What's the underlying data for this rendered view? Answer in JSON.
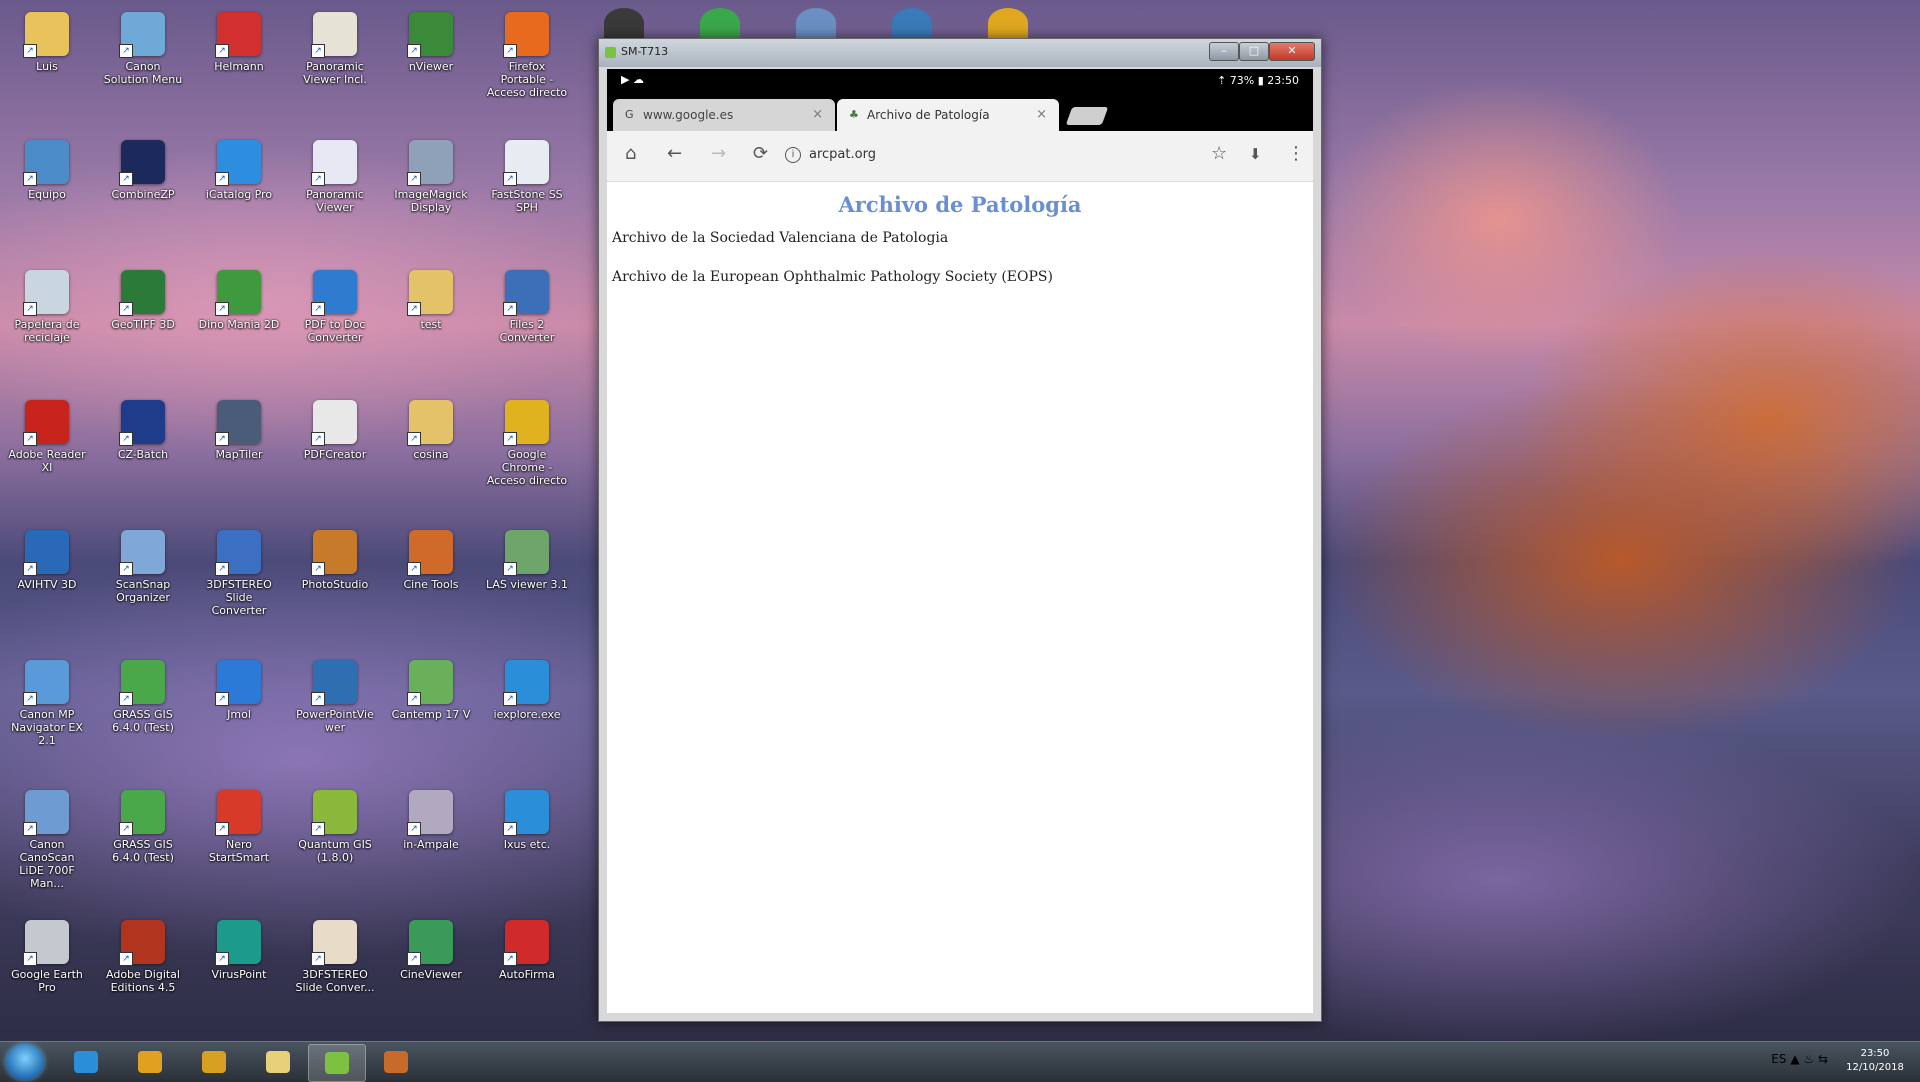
{
  "desktop": {
    "icons": [
      {
        "label": "Luis",
        "color": "#e8c25a",
        "col": 0,
        "row": 0
      },
      {
        "label": "Canon Solution Menu",
        "color": "#6fa9d8",
        "col": 1,
        "row": 0
      },
      {
        "label": "Helmann",
        "color": "#d22f2f",
        "col": 2,
        "row": 0
      },
      {
        "label": "Panoramic Viewer Incl.",
        "color": "#e6e2d6",
        "col": 3,
        "row": 0
      },
      {
        "label": "nViewer",
        "color": "#3b8a3a",
        "col": 4,
        "row": 0
      },
      {
        "label": "Firefox Portable - Acceso directo",
        "color": "#e86a1f",
        "col": 5,
        "row": 0
      },
      {
        "label": "Equipo",
        "color": "#4c8cc9",
        "col": 0,
        "row": 1
      },
      {
        "label": "CombineZP",
        "color": "#1b2a5a",
        "col": 1,
        "row": 1
      },
      {
        "label": "iCatalog Pro",
        "color": "#2d8ee0",
        "col": 2,
        "row": 1
      },
      {
        "label": "Panoramic Viewer",
        "color": "#e8e8f4",
        "col": 3,
        "row": 1
      },
      {
        "label": "ImageMagick Display",
        "color": "#8fa1b8",
        "col": 4,
        "row": 1
      },
      {
        "label": "FastStone SS SPH",
        "color": "#e6ecf2",
        "col": 5,
        "row": 1
      },
      {
        "label": "Papelera de reciclaje",
        "color": "#c9d6e2",
        "col": 0,
        "row": 2
      },
      {
        "label": "GeoTIFF 3D",
        "color": "#2b7a3a",
        "col": 1,
        "row": 2
      },
      {
        "label": "Dino Mania 2D",
        "color": "#3f9a3f",
        "col": 2,
        "row": 2
      },
      {
        "label": "PDF to Doc Converter",
        "color": "#2f7bd0",
        "col": 3,
        "row": 2
      },
      {
        "label": "test",
        "color": "#e3c26a",
        "col": 4,
        "row": 2
      },
      {
        "label": "Files 2 Converter",
        "color": "#3c6fb8",
        "col": 5,
        "row": 2
      },
      {
        "label": "Adobe Reader XI",
        "color": "#c8241e",
        "col": 0,
        "row": 3
      },
      {
        "label": "CZ-Batch",
        "color": "#1f3c8a",
        "col": 1,
        "row": 3
      },
      {
        "label": "MapTiler",
        "color": "#4a5c78",
        "col": 2,
        "row": 3
      },
      {
        "label": "PDFCreator",
        "color": "#e8e8e8",
        "col": 3,
        "row": 3
      },
      {
        "label": "cosina",
        "color": "#e3c26a",
        "col": 4,
        "row": 3
      },
      {
        "label": "Google Chrome - Acceso directo",
        "color": "#e0b21f",
        "col": 5,
        "row": 3
      },
      {
        "label": "AVIHTV 3D",
        "color": "#2a68b8",
        "col": 0,
        "row": 4
      },
      {
        "label": "ScanSnap Organizer",
        "color": "#7fa7d8",
        "col": 1,
        "row": 4
      },
      {
        "label": "3DFSTEREO Slide Converter",
        "color": "#3a6fc2",
        "col": 2,
        "row": 4
      },
      {
        "label": "PhotoStudio",
        "color": "#c67a2a",
        "col": 3,
        "row": 4
      },
      {
        "label": "Cine Tools",
        "color": "#d06a2a",
        "col": 4,
        "row": 4
      },
      {
        "label": "LAS viewer 3.1",
        "color": "#6ea56a",
        "col": 5,
        "row": 4
      },
      {
        "label": "Canon MP Navigator EX 2.1",
        "color": "#5a9ad8",
        "col": 0,
        "row": 5
      },
      {
        "label": "GRASS GIS 6.4.0 (Test)",
        "color": "#4aa84a",
        "col": 1,
        "row": 5
      },
      {
        "label": "Jmol",
        "color": "#2b7ad8",
        "col": 2,
        "row": 5
      },
      {
        "label": "PowerPointViewer",
        "color": "#2d6fb0",
        "col": 3,
        "row": 5
      },
      {
        "label": "Cantemp 17 V",
        "color": "#6ab05a",
        "col": 4,
        "row": 5
      },
      {
        "label": "iexplore.exe",
        "color": "#2a8fd8",
        "col": 5,
        "row": 5
      },
      {
        "label": "Canon CanoScan LiDE 700F Man...",
        "color": "#6e9cd2",
        "col": 0,
        "row": 6
      },
      {
        "label": "GRASS GIS 6.4.0 (Test)",
        "color": "#4aa84a",
        "col": 1,
        "row": 6
      },
      {
        "label": "Nero StartSmart",
        "color": "#d83a2a",
        "col": 2,
        "row": 6
      },
      {
        "label": "Quantum GIS (1.8.0)",
        "color": "#8ab83a",
        "col": 3,
        "row": 6
      },
      {
        "label": "in-Ampale",
        "color": "#b0a9c0",
        "col": 4,
        "row": 6
      },
      {
        "label": "Ixus etc.",
        "color": "#2a8fd8",
        "col": 5,
        "row": 6
      },
      {
        "label": "Google Earth Pro",
        "color": "#c4c9d0",
        "col": 0,
        "row": 7
      },
      {
        "label": "Adobe Digital Editions 4.5",
        "color": "#b0341e",
        "col": 1,
        "row": 7
      },
      {
        "label": "VirusPoint",
        "color": "#1c9a8c",
        "col": 2,
        "row": 7
      },
      {
        "label": "3DFSTEREO Slide Conver...",
        "color": "#e6dcc8",
        "col": 3,
        "row": 7
      },
      {
        "label": "CineViewer",
        "color": "#3a9a5a",
        "col": 4,
        "row": 7
      },
      {
        "label": "AutoFirma",
        "color": "#d02a2a",
        "col": 5,
        "row": 7
      }
    ],
    "top_icon_colors": [
      "#3a3a3a",
      "#3aa84a",
      "#6a8fc2",
      "#3a7ab8",
      "#e0a81f"
    ]
  },
  "emulator": {
    "title": "SM-T713",
    "btn_min": "–",
    "btn_max": "□",
    "btn_close": "✕"
  },
  "android": {
    "status_left": "▶ ☁",
    "status_right": "⇡ 73% ▮ 23:50"
  },
  "browser": {
    "tabs": [
      {
        "title": "www.google.es",
        "favicon": "G",
        "close": "×"
      },
      {
        "title": "Archivo de Patología",
        "favicon": "♣",
        "close": "×"
      }
    ],
    "toolbar": {
      "home_icon": "⌂",
      "back_icon": "←",
      "forward_icon": "→",
      "reload_icon": "⟳",
      "info_icon": "i",
      "url": "arcpat.org",
      "star_icon": "☆",
      "download_icon": "⬇",
      "menu_icon": "⋮"
    }
  },
  "page": {
    "heading": "Archivo de Patología",
    "links": [
      "Archivo de la Sociedad Valenciana de Patologia",
      "Archivo de la European Ophthalmic Pathology Society (EOPS)"
    ]
  },
  "taskbar": {
    "clock_time": "23:50",
    "clock_date": "12/10/2018",
    "lang": "ES",
    "tray_icons": "▲ ♨ ⇆",
    "apps": [
      {
        "name": "ie",
        "color": "#2a8fd8"
      },
      {
        "name": "media",
        "color": "#e0a020"
      },
      {
        "name": "chrome",
        "color": "#d8a020"
      },
      {
        "name": "explorer",
        "color": "#e8cf7a"
      },
      {
        "name": "android",
        "color": "#7cc142"
      },
      {
        "name": "game",
        "color": "#c86a2a"
      }
    ]
  }
}
